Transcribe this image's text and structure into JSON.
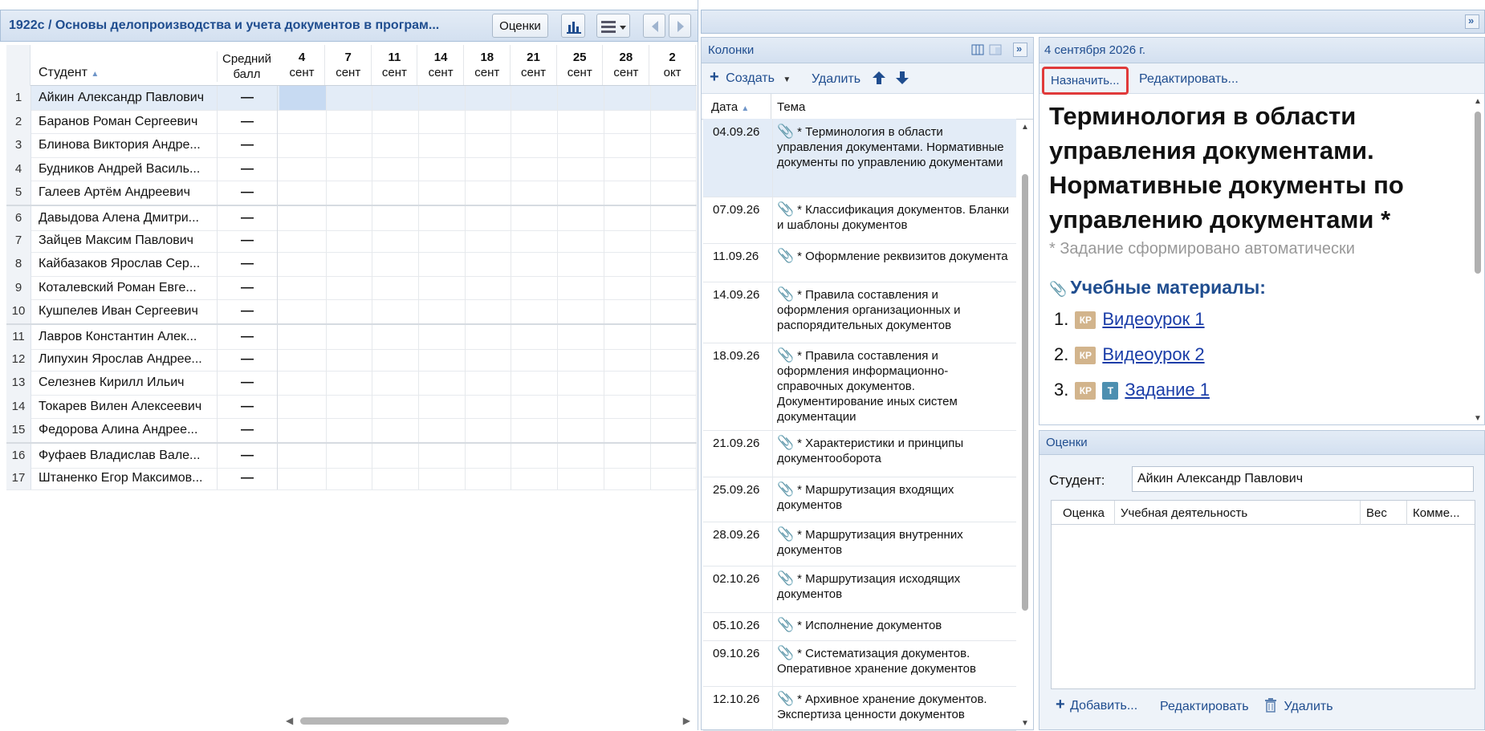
{
  "journal": {
    "title": "1922с / Основы делопроизводства и учета документов в програм...",
    "grades_button": "Оценки",
    "col_student": "Студент",
    "col_avg": "Средний балл",
    "dates": [
      {
        "day": "4",
        "month": "сент"
      },
      {
        "day": "7",
        "month": "сент"
      },
      {
        "day": "11",
        "month": "сент"
      },
      {
        "day": "14",
        "month": "сент"
      },
      {
        "day": "18",
        "month": "сент"
      },
      {
        "day": "21",
        "month": "сент"
      },
      {
        "day": "25",
        "month": "сент"
      },
      {
        "day": "28",
        "month": "сент"
      },
      {
        "day": "2",
        "month": "окт"
      }
    ],
    "students": [
      {
        "n": "1",
        "name": "Айкин Александр Павлович",
        "avg": "—"
      },
      {
        "n": "2",
        "name": "Баранов Роман Сергеевич",
        "avg": "—"
      },
      {
        "n": "3",
        "name": "Блинова Виктория Андре...",
        "avg": "—"
      },
      {
        "n": "4",
        "name": "Будников Андрей Василь...",
        "avg": "—"
      },
      {
        "n": "5",
        "name": "Галеев Артём Андреевич",
        "avg": "—"
      },
      {
        "n": "6",
        "name": "Давыдова Алена Дмитри...",
        "avg": "—"
      },
      {
        "n": "7",
        "name": "Зайцев Максим Павлович",
        "avg": "—"
      },
      {
        "n": "8",
        "name": "Кайбазаков Ярослав Сер...",
        "avg": "—"
      },
      {
        "n": "9",
        "name": "Коталевский Роман Евге...",
        "avg": "—"
      },
      {
        "n": "10",
        "name": "Кушпелев Иван Сергеевич",
        "avg": "—"
      },
      {
        "n": "11",
        "name": "Лавров Константин Алек...",
        "avg": "—"
      },
      {
        "n": "12",
        "name": "Липухин Ярослав Андрее...",
        "avg": "—"
      },
      {
        "n": "13",
        "name": "Селезнев Кирилл Ильич",
        "avg": "—"
      },
      {
        "n": "14",
        "name": "Токарев Вилен Алексеевич",
        "avg": "—"
      },
      {
        "n": "15",
        "name": "Федорова Алина Андрее...",
        "avg": "—"
      },
      {
        "n": "16",
        "name": "Фуфаев Владислав Вале...",
        "avg": "—"
      },
      {
        "n": "17",
        "name": "Штаненко Егор Максимов...",
        "avg": "—"
      }
    ]
  },
  "columns": {
    "title": "Колонки",
    "create": "Создать",
    "delete": "Удалить",
    "col_date": "Дата",
    "col_topic": "Тема",
    "rows": [
      {
        "date": "04.09.26",
        "topic": "* Терминология в области управления документами. Нормативные документы по управлению документами"
      },
      {
        "date": "07.09.26",
        "topic": "* Классификация документов. Бланки и шаблоны документов"
      },
      {
        "date": "11.09.26",
        "topic": "* Оформление реквизитов документа"
      },
      {
        "date": "14.09.26",
        "topic": "* Правила составления и оформления организационных и распорядительных документов"
      },
      {
        "date": "18.09.26",
        "topic": "* Правила составления и оформления информационно-справочных документов. Документирование иных систем документации"
      },
      {
        "date": "21.09.26",
        "topic": "* Характеристики и принципы документооборота"
      },
      {
        "date": "25.09.26",
        "topic": "* Маршрутизация входящих документов"
      },
      {
        "date": "28.09.26",
        "topic": "* Маршрутизация внутренних документов"
      },
      {
        "date": "02.10.26",
        "topic": "* Маршрутизация исходящих документов"
      },
      {
        "date": "05.10.26",
        "topic": "* Исполнение документов"
      },
      {
        "date": "09.10.26",
        "topic": "* Систематизация документов. Оперативное хранение документов"
      },
      {
        "date": "12.10.26",
        "topic": "* Архивное хранение документов. Экспертиза ценности документов"
      }
    ]
  },
  "lesson": {
    "date": "4 сентября 2026 г.",
    "assign": "Назначить...",
    "edit": "Редактировать...",
    "heading": "Терминология в области управления документами. Нормативные документы по управлению документами *",
    "auto_note": "* Задание сформировано автоматически",
    "materials_title": "Учебные материалы:",
    "materials": [
      {
        "num": "1.",
        "badge": "КР",
        "badge2": "",
        "label": "Видеоурок 1"
      },
      {
        "num": "2.",
        "badge": "КР",
        "badge2": "",
        "label": "Видеоурок 2"
      },
      {
        "num": "3.",
        "badge": "КР",
        "badge2": "Т",
        "label": "Задание 1"
      }
    ]
  },
  "grades": {
    "title": "Оценки",
    "student_label": "Студент:",
    "student_value": "Айкин Александр Павлович",
    "col_grade": "Оценка",
    "col_activity": "Учебная деятельность",
    "col_weight": "Вес",
    "col_comment": "Комме...",
    "add": "Добавить...",
    "edit": "Редактировать",
    "delete": "Удалить"
  }
}
